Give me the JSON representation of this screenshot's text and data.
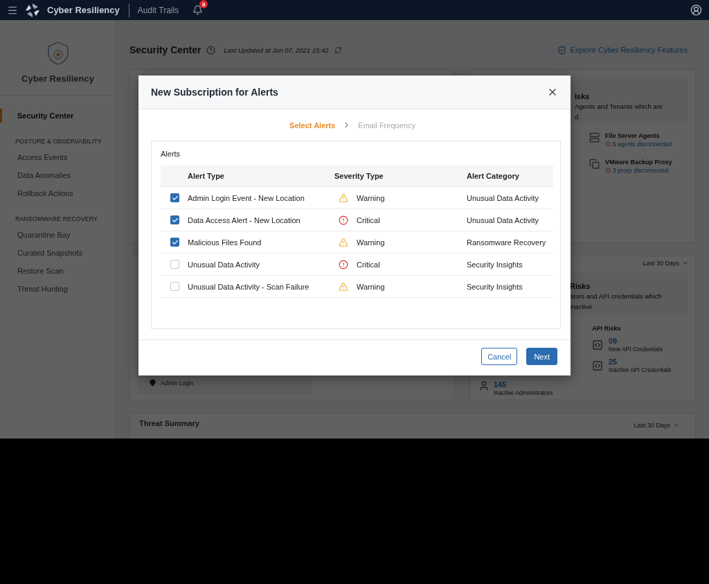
{
  "top_bar": {
    "app_name": "Cyber Resiliency",
    "link": "Audit Trails",
    "notification_count": "8"
  },
  "sidebar": {
    "title": "Cyber Resiliency",
    "items": [
      {
        "label": "Security Center",
        "selected": true
      }
    ],
    "groups": [
      {
        "heading": "POSTURE & OBSERVABILITY",
        "items": [
          {
            "label": "Access Events",
            "selected": false
          },
          {
            "label": "Data Anomalies",
            "selected": false
          },
          {
            "label": "Rollback Actions",
            "selected": false
          }
        ]
      },
      {
        "heading": "RANSOMWARE RECOVERY",
        "items": [
          {
            "label": "Quarantine Bay",
            "selected": false
          },
          {
            "label": "Curated Snapshots",
            "selected": false
          },
          {
            "label": "Restore Scan",
            "selected": false
          },
          {
            "label": "Threat Hunting",
            "selected": false
          }
        ]
      }
    ]
  },
  "header": {
    "title": "Security Center",
    "last_updated": "Last Updated at Jun 07, 2021 15:42",
    "explore_button": "Explore Cyber Resiliency Features"
  },
  "infrastructure_card": {
    "title_fragment": "isks",
    "description_fragments": [
      "Agents and Tenants which are",
      "d."
    ],
    "items": [
      {
        "kind": "server",
        "title": "File Server Agents",
        "status": "5 agents disconnected"
      },
      {
        "kind": "proxy",
        "title": "VMware Backup Proxy",
        "status": "3 proxy disconnected"
      }
    ]
  },
  "login_card": {
    "label": "Admin Login"
  },
  "access_card": {
    "period": "Last 30 Days",
    "title_fragment": "Risks",
    "description_fragments": [
      "ators and API credentials which",
      "inactive"
    ],
    "admin": {
      "value": "145",
      "label": "Inactive Administrators"
    },
    "api_risks": {
      "title": "API Risks",
      "items": [
        {
          "value": "09",
          "label": "New API Credentials"
        },
        {
          "value": "25",
          "label": "Inactive API Credentials"
        }
      ]
    }
  },
  "threat_summary": {
    "title": "Threat Summary",
    "period": "Last 30 Days"
  },
  "modal": {
    "title": "New Subscription for Alerts",
    "steps": [
      {
        "label": "Select Alerts",
        "selected": true
      },
      {
        "label": "Email Frequency",
        "selected": false
      }
    ],
    "panel_title": "Alerts",
    "columns": [
      "Alert Type",
      "Severity Type",
      "Alert Category"
    ],
    "rows": [
      {
        "checked": true,
        "alert_type": "Admin Login Event - New Location",
        "severity": {
          "kind": "warning",
          "label": "Warning"
        },
        "category": "Unusual Data Activity"
      },
      {
        "checked": true,
        "alert_type": "Data Access Alert - New Location",
        "severity": {
          "kind": "critical",
          "label": "Critical"
        },
        "category": "Unusual Data Activity"
      },
      {
        "checked": true,
        "alert_type": "Malicious Files Found",
        "severity": {
          "kind": "warning",
          "label": "Warning"
        },
        "category": "Ransomware Recovery"
      },
      {
        "checked": false,
        "alert_type": "Unusual Data Activity",
        "severity": {
          "kind": "critical",
          "label": "Critical"
        },
        "category": "Security Insights"
      },
      {
        "checked": false,
        "alert_type": "Unusual Data Activity - Scan Failure",
        "severity": {
          "kind": "warning",
          "label": "Warning"
        },
        "category": "Security Insights"
      }
    ],
    "buttons": {
      "cancel": "Cancel",
      "next": "Next"
    }
  }
}
